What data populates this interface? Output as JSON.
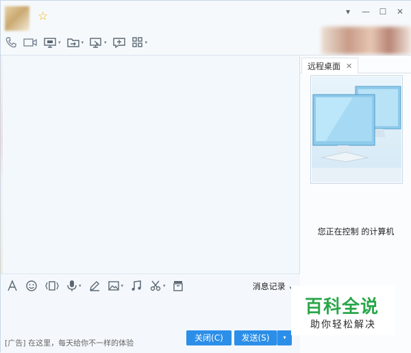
{
  "window": {
    "controls": {
      "menu": "▾",
      "minimize": "—",
      "maximize": "☐",
      "close": "✕"
    }
  },
  "toolbar": {
    "items": [
      {
        "name": "voice-call-icon"
      },
      {
        "name": "video-call-icon"
      },
      {
        "name": "screen-share-icon",
        "caret": "▾"
      },
      {
        "name": "file-transfer-icon",
        "caret": "▾"
      },
      {
        "name": "remote-desktop-icon",
        "caret": "▾"
      },
      {
        "name": "add-app-icon"
      },
      {
        "name": "apps-grid-icon",
        "caret": "▾"
      }
    ]
  },
  "side": {
    "tab_label": "远程桌面",
    "tab_close": "✕",
    "status_text": "您正在控制 的计算机"
  },
  "input_toolbar": {
    "history_label": "消息记录",
    "caret": "▾"
  },
  "footer": {
    "ad_text": "[广告] 在这里，每天给你不一样的体验",
    "close_label": "关闭(C)",
    "send_label": "发送(S)",
    "send_dropdown": "▾"
  },
  "watermark": {
    "title": "百科全说",
    "subtitle": "助你轻松解决"
  },
  "colors": {
    "accent": "#2b8ee8",
    "star": "#f0b400",
    "watermark_green": "#2aa64a"
  }
}
